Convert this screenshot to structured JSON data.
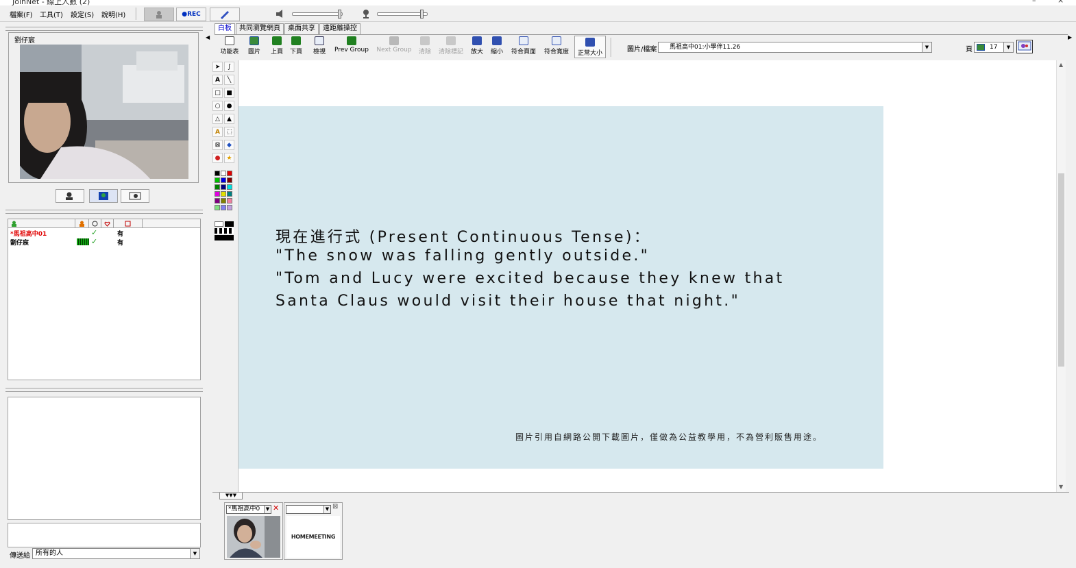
{
  "window": {
    "title": "JoinNet - 線上人數 (2)",
    "minimize": "–",
    "close": "×"
  },
  "menu": {
    "file": "檔案(F)",
    "tools": "工具(T)",
    "settings": "設定(S)",
    "help": "說明(H)"
  },
  "toolbar": {
    "rec_label": "●REC"
  },
  "video": {
    "participant_name": "劉仔宸"
  },
  "user_list": {
    "rows": [
      {
        "name": "*馬祖高中01",
        "check": "✓",
        "status": "有",
        "color": "#e00000"
      },
      {
        "name": "劉仔宸",
        "check": "✓",
        "status": "有",
        "color": "#000000"
      }
    ]
  },
  "chat": {
    "send_to_label": "傳送給",
    "send_to_value": "所有的人"
  },
  "tabs": [
    "白板",
    "共同瀏覽網頁",
    "桌面共享",
    "遠距離操控"
  ],
  "whiteboard_toolbar": {
    "buttons": [
      {
        "label": "功能表",
        "enabled": true
      },
      {
        "label": "圖片",
        "enabled": true
      },
      {
        "label": "上頁",
        "enabled": true
      },
      {
        "label": "下頁",
        "enabled": true
      },
      {
        "label": "檢視",
        "enabled": true
      },
      {
        "label": "Prev Group",
        "enabled": true
      },
      {
        "label": "Next Group",
        "enabled": false
      },
      {
        "label": "清除",
        "enabled": false
      },
      {
        "label": "清除標記",
        "enabled": false
      },
      {
        "label": "放大",
        "enabled": true
      },
      {
        "label": "縮小",
        "enabled": true
      },
      {
        "label": "符合頁面",
        "enabled": true
      },
      {
        "label": "符合寬度",
        "enabled": true
      },
      {
        "label": "正常大小",
        "enabled": true
      }
    ],
    "file_label": "圖片/檔案",
    "file_value": "馬祖高中01:小學伴11.26",
    "page_label": "頁",
    "page_value": "17"
  },
  "slide": {
    "line1": "現在進行式 (Present Continuous Tense)：",
    "line2": "\"The snow was falling gently outside.\"",
    "line3": "\"Tom and Lucy were excited because they knew that",
    "line4": "Santa Claus would visit their house that night.\"",
    "note": "圖片引用自網路公開下載圖片，僅做為公益教學用，不為營利販售用途。",
    "background_color": "#d6e8ee"
  },
  "thumbnails": [
    {
      "select_value": "*馬祖高中0",
      "content": "webcam"
    },
    {
      "select_value": "",
      "content": "logo",
      "logo_text": "HOMEMEETING"
    }
  ]
}
